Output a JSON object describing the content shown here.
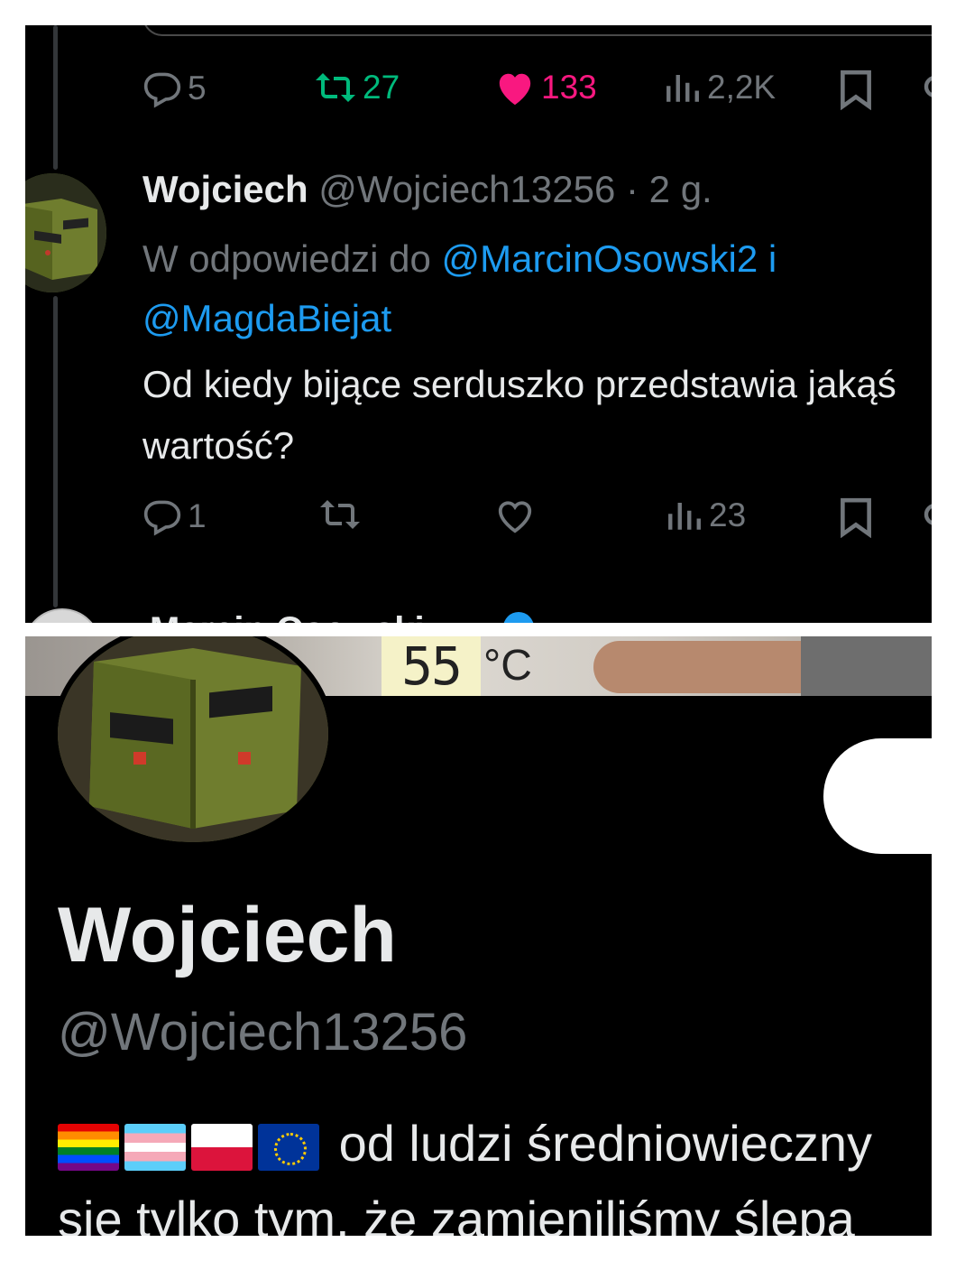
{
  "tweet": {
    "actions_top": {
      "replies": "5",
      "retweets": "27",
      "likes": "133",
      "views": "2,2K"
    },
    "author": {
      "name": "Wojciech",
      "handle": "@Wojciech13256",
      "time": "· 2 g."
    },
    "reply_prefix": "W odpowiedzi do",
    "reply_user1": "@MarcinOsowski2",
    "reply_joiner": "i",
    "reply_user2": "@MagdaBiejat",
    "text": "Od kiedy bijące serduszko przedstawia jakąś wartość?",
    "actions": {
      "replies": "1",
      "views": "23"
    },
    "next_author": "Marcin Osowski"
  },
  "profile": {
    "banner_readout": "55",
    "banner_unit": "°C",
    "name": "Wojciech",
    "handle": "@Wojciech13256",
    "bio_line1": "od ludzi średniowieczny",
    "bio_line2": "się tylko tym, że zamieniliśmy ślepą"
  },
  "colors": {
    "background": "#000000",
    "text": "#e7e9ea",
    "muted": "#71767b",
    "link": "#1d9bf0",
    "retweet_active": "#00ba7c",
    "like_active": "#f91880"
  }
}
